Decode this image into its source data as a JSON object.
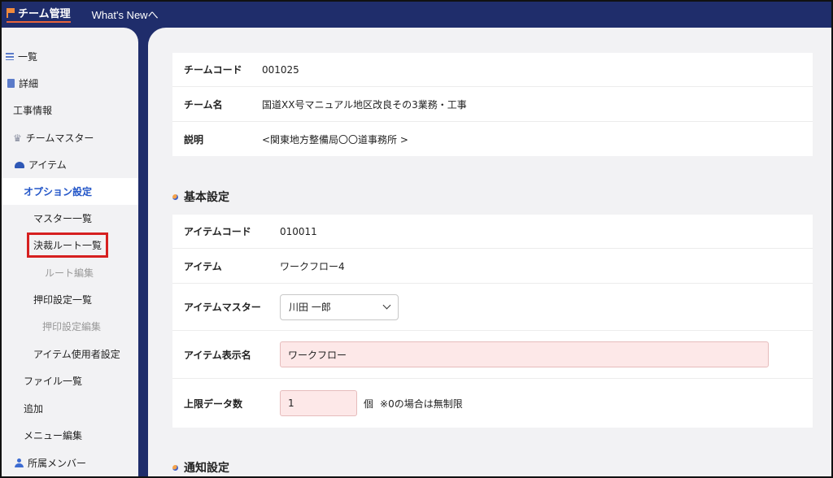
{
  "header": {
    "brand": "チーム管理",
    "whats_new": "What's Newへ"
  },
  "sidebar": {
    "items": [
      {
        "label": "一覧",
        "icon": "list-icon"
      },
      {
        "label": "詳細",
        "icon": "document-icon"
      },
      {
        "label": "工事情報"
      },
      {
        "label": "チームマスター",
        "icon": "crown-icon"
      },
      {
        "label": "アイテム",
        "icon": "item-icon"
      },
      {
        "label": "オプション設定",
        "active": true
      },
      {
        "label": "マスター一覧"
      },
      {
        "label": "決裁ルート一覧",
        "highlighted": true
      },
      {
        "label": "ルート編集",
        "disabled": true
      },
      {
        "label": "押印設定一覧"
      },
      {
        "label": "押印設定編集",
        "disabled": true
      },
      {
        "label": "アイテム使用者設定"
      },
      {
        "label": "ファイル一覧"
      },
      {
        "label": "追加"
      },
      {
        "label": "メニュー編集"
      },
      {
        "label": "所属メンバー",
        "icon": "person-icon"
      }
    ]
  },
  "team": {
    "code_label": "チームコード",
    "code_value": "001025",
    "name_label": "チーム名",
    "name_value": "国道XX号マニュアル地区改良その3業務・工事",
    "desc_label": "説明",
    "desc_value": "<関東地方整備局〇〇道事務所 >"
  },
  "basic": {
    "title": "基本設定",
    "item_code_label": "アイテムコード",
    "item_code_value": "010011",
    "item_label": "アイテム",
    "item_value": "ワークフロー4",
    "master_label": "アイテムマスター",
    "master_selected": "川田 一郎",
    "display_name_label": "アイテム表示名",
    "display_name_value": "ワークフロー",
    "limit_label": "上限データ数",
    "limit_value": "1",
    "limit_unit": "個",
    "limit_note": "※0の場合は無制限"
  },
  "notify": {
    "title": "通知設定"
  },
  "colors": {
    "header_bg": "#1f2d6b",
    "active_link": "#2356c8",
    "highlight_border": "#d62020",
    "input_pink": "#fde8e8"
  }
}
